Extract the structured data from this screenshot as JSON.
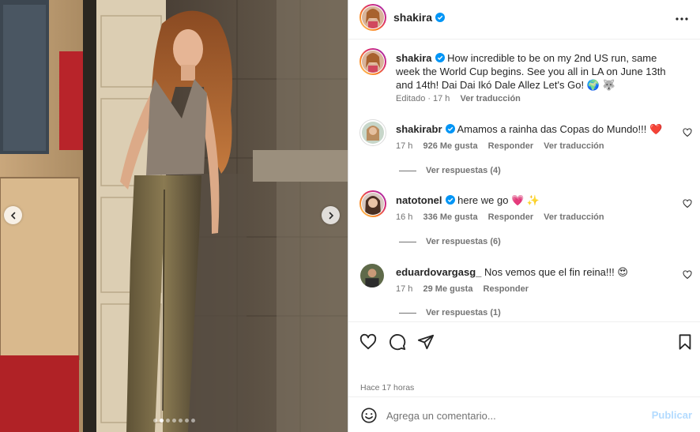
{
  "author": {
    "username": "shakira"
  },
  "caption": {
    "username": "shakira",
    "text": "How incredible to be on my 2nd US run, same week the World Cup begins. See you all in LA on June 13th and 14th! Dai Dai Ikó Dale Allez Let's Go! 🌍 🐺",
    "edited_label": "Editado",
    "time": "17 h",
    "translate": "Ver traducción"
  },
  "comments": [
    {
      "username": "shakirabr",
      "text": "Amamos a rainha das Copas do Mundo!!! ❤️",
      "verified": true,
      "time": "17 h",
      "likes": "926 Me gusta",
      "reply": "Responder",
      "translate": "Ver traducción",
      "view_replies": "Ver respuestas (4)"
    },
    {
      "username": "natotonel",
      "text": "here we go 💗 ✨",
      "verified": true,
      "time": "16 h",
      "likes": "336 Me gusta",
      "reply": "Responder",
      "translate": "Ver traducción",
      "view_replies": "Ver respuestas (6)"
    },
    {
      "username": "eduardovargasg_",
      "text": "Nos vemos que el fin reina!!! 😍",
      "verified": false,
      "time": "17 h",
      "likes": "29 Me gusta",
      "reply": "Responder",
      "view_replies": "Ver respuestas (1)"
    }
  ],
  "post_time": "Hace 17 horas",
  "composer": {
    "placeholder": "Agrega un comentario...",
    "post_label": "Publicar"
  },
  "carousel": {
    "slides": 7,
    "active_index": 1
  },
  "colors": {
    "verified": "#0095f6",
    "post_disabled": "#b3dbff",
    "muted_text": "#737373"
  },
  "icons": [
    "more-icon",
    "heart-icon",
    "comment-icon",
    "share-icon",
    "bookmark-icon",
    "emoji-icon",
    "chevron-left-icon",
    "chevron-right-icon",
    "verified-icon"
  ]
}
